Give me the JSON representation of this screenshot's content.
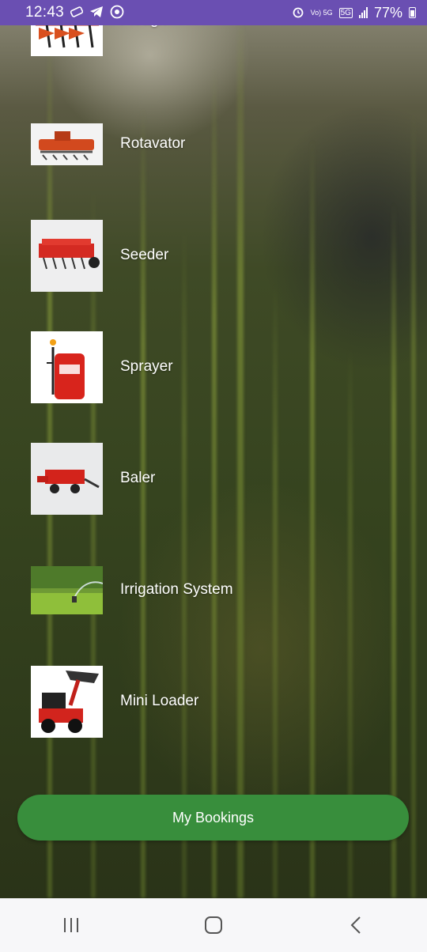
{
  "status_bar": {
    "time": "12:43",
    "network": "5G",
    "volte": "Vo) 5G",
    "battery": "77%"
  },
  "equipment": [
    {
      "label": "Plough",
      "icon": "plough-image"
    },
    {
      "label": "Rotavator",
      "icon": "rotavator-image"
    },
    {
      "label": "Seeder",
      "icon": "seeder-image"
    },
    {
      "label": "Sprayer",
      "icon": "sprayer-image"
    },
    {
      "label": "Baler",
      "icon": "baler-image"
    },
    {
      "label": "Irrigation System",
      "icon": "irrigation-image"
    },
    {
      "label": "Mini Loader",
      "icon": "mini-loader-image"
    }
  ],
  "bookings_button": "My Bookings",
  "colors": {
    "status_bar": "#6a4fb2",
    "button": "#388e3c",
    "nav_bar": "#f7f7f9"
  }
}
